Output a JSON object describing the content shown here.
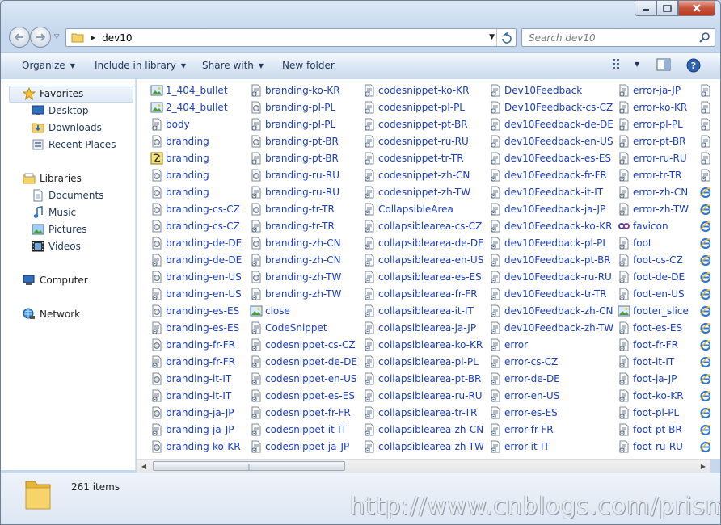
{
  "window": {
    "address": {
      "path_segment": "dev10"
    },
    "search": {
      "placeholder": "Search dev10"
    }
  },
  "toolbar": {
    "organize": "Organize",
    "include_in_library": "Include in library",
    "share_with": "Share with",
    "new_folder": "New folder"
  },
  "sidebar": {
    "favorites": "Favorites",
    "desktop": "Desktop",
    "downloads": "Downloads",
    "recent_places": "Recent Places",
    "libraries": "Libraries",
    "documents": "Documents",
    "music": "Music",
    "pictures": "Pictures",
    "videos": "Videos",
    "computer": "Computer",
    "network": "Network"
  },
  "files": {
    "col1": [
      {
        "name": "1_404_bullet",
        "icon": "image-icon"
      },
      {
        "name": "2_404_bullet",
        "icon": "image-icon"
      },
      {
        "name": "body",
        "icon": "script-icon"
      },
      {
        "name": "branding",
        "icon": "config-icon"
      },
      {
        "name": "branding",
        "icon": "js-icon"
      },
      {
        "name": "branding",
        "icon": "config-icon"
      },
      {
        "name": "branding",
        "icon": "config-icon"
      },
      {
        "name": "branding-cs-CZ",
        "icon": "config-icon"
      },
      {
        "name": "branding-cs-CZ",
        "icon": "config-icon"
      },
      {
        "name": "branding-de-DE",
        "icon": "config-icon"
      },
      {
        "name": "branding-de-DE",
        "icon": "script-icon"
      },
      {
        "name": "branding-en-US",
        "icon": "config-icon"
      },
      {
        "name": "branding-en-US",
        "icon": "script-icon"
      },
      {
        "name": "branding-es-ES",
        "icon": "config-icon"
      },
      {
        "name": "branding-es-ES",
        "icon": "script-icon"
      },
      {
        "name": "branding-fr-FR",
        "icon": "config-icon"
      },
      {
        "name": "branding-fr-FR",
        "icon": "script-icon"
      },
      {
        "name": "branding-it-IT",
        "icon": "config-icon"
      },
      {
        "name": "branding-it-IT",
        "icon": "script-icon"
      },
      {
        "name": "branding-ja-JP",
        "icon": "config-icon"
      },
      {
        "name": "branding-ja-JP",
        "icon": "script-icon"
      },
      {
        "name": "branding-ko-KR",
        "icon": "config-icon"
      }
    ],
    "col2": [
      {
        "name": "branding-ko-KR",
        "icon": "script-icon"
      },
      {
        "name": "branding-pl-PL",
        "icon": "config-icon"
      },
      {
        "name": "branding-pl-PL",
        "icon": "script-icon"
      },
      {
        "name": "branding-pt-BR",
        "icon": "config-icon"
      },
      {
        "name": "branding-pt-BR",
        "icon": "script-icon"
      },
      {
        "name": "branding-ru-RU",
        "icon": "config-icon"
      },
      {
        "name": "branding-ru-RU",
        "icon": "script-icon"
      },
      {
        "name": "branding-tr-TR",
        "icon": "config-icon"
      },
      {
        "name": "branding-tr-TR",
        "icon": "script-icon"
      },
      {
        "name": "branding-zh-CN",
        "icon": "config-icon"
      },
      {
        "name": "branding-zh-CN",
        "icon": "script-icon"
      },
      {
        "name": "branding-zh-TW",
        "icon": "config-icon"
      },
      {
        "name": "branding-zh-TW",
        "icon": "script-icon"
      },
      {
        "name": "close",
        "icon": "image-icon"
      },
      {
        "name": "CodeSnippet",
        "icon": "script-icon"
      },
      {
        "name": "codesnippet-cs-CZ",
        "icon": "script-icon"
      },
      {
        "name": "codesnippet-de-DE",
        "icon": "script-icon"
      },
      {
        "name": "codesnippet-en-US",
        "icon": "script-icon"
      },
      {
        "name": "codesnippet-es-ES",
        "icon": "script-icon"
      },
      {
        "name": "codesnippet-fr-FR",
        "icon": "script-icon"
      },
      {
        "name": "codesnippet-it-IT",
        "icon": "script-icon"
      },
      {
        "name": "codesnippet-ja-JP",
        "icon": "script-icon"
      }
    ],
    "col3": [
      {
        "name": "codesnippet-ko-KR",
        "icon": "script-icon"
      },
      {
        "name": "codesnippet-pl-PL",
        "icon": "script-icon"
      },
      {
        "name": "codesnippet-pt-BR",
        "icon": "script-icon"
      },
      {
        "name": "codesnippet-ru-RU",
        "icon": "script-icon"
      },
      {
        "name": "codesnippet-tr-TR",
        "icon": "script-icon"
      },
      {
        "name": "codesnippet-zh-CN",
        "icon": "script-icon"
      },
      {
        "name": "codesnippet-zh-TW",
        "icon": "script-icon"
      },
      {
        "name": "CollapsibleArea",
        "icon": "script-icon"
      },
      {
        "name": "collapsiblearea-cs-CZ",
        "icon": "script-icon"
      },
      {
        "name": "collapsiblearea-de-DE",
        "icon": "script-icon"
      },
      {
        "name": "collapsiblearea-en-US",
        "icon": "script-icon"
      },
      {
        "name": "collapsiblearea-es-ES",
        "icon": "script-icon"
      },
      {
        "name": "collapsiblearea-fr-FR",
        "icon": "script-icon"
      },
      {
        "name": "collapsiblearea-it-IT",
        "icon": "script-icon"
      },
      {
        "name": "collapsiblearea-ja-JP",
        "icon": "script-icon"
      },
      {
        "name": "collapsiblearea-ko-KR",
        "icon": "script-icon"
      },
      {
        "name": "collapsiblearea-pl-PL",
        "icon": "script-icon"
      },
      {
        "name": "collapsiblearea-pt-BR",
        "icon": "script-icon"
      },
      {
        "name": "collapsiblearea-ru-RU",
        "icon": "script-icon"
      },
      {
        "name": "collapsiblearea-tr-TR",
        "icon": "script-icon"
      },
      {
        "name": "collapsiblearea-zh-CN",
        "icon": "script-icon"
      },
      {
        "name": "collapsiblearea-zh-TW",
        "icon": "script-icon"
      }
    ],
    "col4": [
      {
        "name": "Dev10Feedback",
        "icon": "script-icon"
      },
      {
        "name": "Dev10Feedback-cs-CZ",
        "icon": "script-icon"
      },
      {
        "name": "dev10Feedback-de-DE",
        "icon": "script-icon"
      },
      {
        "name": "dev10Feedback-en-US",
        "icon": "script-icon"
      },
      {
        "name": "dev10Feedback-es-ES",
        "icon": "script-icon"
      },
      {
        "name": "dev10Feedback-fr-FR",
        "icon": "script-icon"
      },
      {
        "name": "dev10Feedback-it-IT",
        "icon": "script-icon"
      },
      {
        "name": "dev10Feedback-ja-JP",
        "icon": "script-icon"
      },
      {
        "name": "dev10Feedback-ko-KR",
        "icon": "script-icon"
      },
      {
        "name": "dev10Feedback-pl-PL",
        "icon": "script-icon"
      },
      {
        "name": "dev10Feedback-pt-BR",
        "icon": "script-icon"
      },
      {
        "name": "dev10Feedback-ru-RU",
        "icon": "script-icon"
      },
      {
        "name": "dev10Feedback-tr-TR",
        "icon": "script-icon"
      },
      {
        "name": "dev10Feedback-zh-CN",
        "icon": "script-icon"
      },
      {
        "name": "dev10Feedback-zh-TW",
        "icon": "script-icon"
      },
      {
        "name": "error",
        "icon": "script-icon"
      },
      {
        "name": "error-cs-CZ",
        "icon": "script-icon"
      },
      {
        "name": "error-de-DE",
        "icon": "script-icon"
      },
      {
        "name": "error-en-US",
        "icon": "script-icon"
      },
      {
        "name": "error-es-ES",
        "icon": "script-icon"
      },
      {
        "name": "error-fr-FR",
        "icon": "script-icon"
      },
      {
        "name": "error-it-IT",
        "icon": "script-icon"
      }
    ],
    "col5": [
      {
        "name": "error-ja-JP",
        "icon": "script-icon"
      },
      {
        "name": "error-ko-KR",
        "icon": "script-icon"
      },
      {
        "name": "error-pl-PL",
        "icon": "script-icon"
      },
      {
        "name": "error-pt-BR",
        "icon": "script-icon"
      },
      {
        "name": "error-ru-RU",
        "icon": "script-icon"
      },
      {
        "name": "error-tr-TR",
        "icon": "script-icon"
      },
      {
        "name": "error-zh-CN",
        "icon": "script-icon"
      },
      {
        "name": "error-zh-TW",
        "icon": "script-icon"
      },
      {
        "name": "favicon",
        "icon": "favicon-icon"
      },
      {
        "name": "foot",
        "icon": "script-icon"
      },
      {
        "name": "foot-cs-CZ",
        "icon": "script-icon"
      },
      {
        "name": "foot-de-DE",
        "icon": "script-icon"
      },
      {
        "name": "foot-en-US",
        "icon": "script-icon"
      },
      {
        "name": "footer_slice",
        "icon": "image-icon"
      },
      {
        "name": "foot-es-ES",
        "icon": "script-icon"
      },
      {
        "name": "foot-fr-FR",
        "icon": "script-icon"
      },
      {
        "name": "foot-it-IT",
        "icon": "script-icon"
      },
      {
        "name": "foot-ja-JP",
        "icon": "script-icon"
      },
      {
        "name": "foot-ko-KR",
        "icon": "script-icon"
      },
      {
        "name": "foot-pl-PL",
        "icon": "script-icon"
      },
      {
        "name": "foot-pt-BR",
        "icon": "script-icon"
      },
      {
        "name": "foot-ru-RU",
        "icon": "script-icon"
      }
    ],
    "col6_icons": [
      "script-icon",
      "script-icon",
      "script-icon",
      "script-icon",
      "script-icon",
      "script-icon",
      "ie-icon",
      "ie-icon",
      "ie-icon",
      "ie-icon",
      "ie-icon",
      "ie-icon",
      "ie-icon",
      "ie-icon",
      "ie-icon",
      "ie-icon",
      "ie-icon",
      "ie-icon",
      "ie-icon",
      "ie-icon",
      "ie-icon",
      "ie-icon"
    ]
  },
  "details": {
    "count": "261 items"
  },
  "watermark": "http://www.cnblogs.com/prism/",
  "colors": {
    "link": "#1a3fbf",
    "chrome": "#c6d8ee"
  }
}
